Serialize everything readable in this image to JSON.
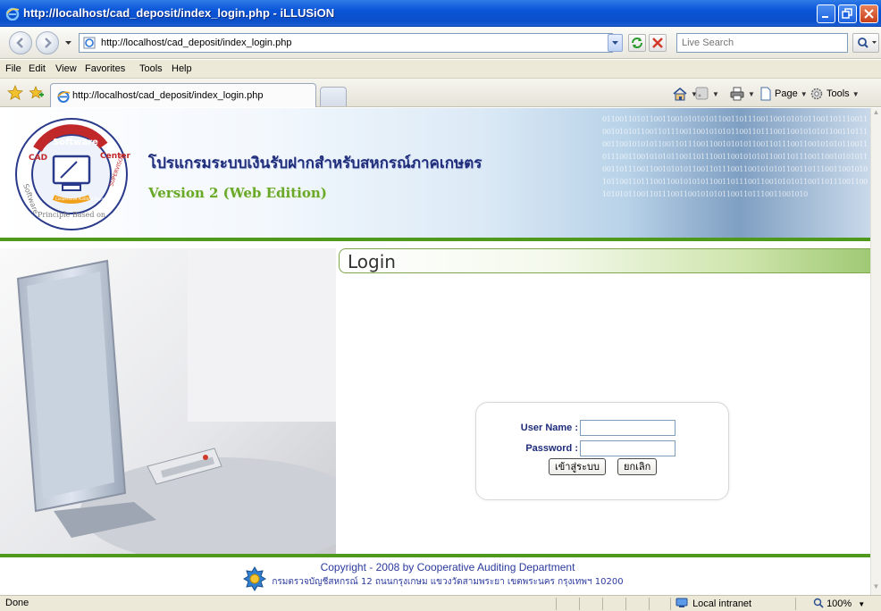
{
  "window": {
    "title": "http://localhost/cad_deposit/index_login.php - iLLUSiON"
  },
  "address_bar": {
    "url": "http://localhost/cad_deposit/index_login.php",
    "search_placeholder": "Live Search"
  },
  "menu": [
    "File",
    "Edit",
    "View",
    "Favorites",
    "Tools",
    "Help"
  ],
  "tabs": [
    {
      "title": "http://localhost/cad_deposit/index_login.php"
    }
  ],
  "command_bar": {
    "page_label": "Page",
    "tools_label": "Tools"
  },
  "banner": {
    "app_title": "โปรแกรมระบบเงินรับฝากสำหรับสหกรณ์ภาคเกษตร",
    "version": "Version 2 (Web Edition)",
    "logo_text": {
      "top": "Software",
      "left": "CAD Software",
      "center": "Center",
      "bottom": "Principle Based on",
      "badge": "Cooperative Auditing Department",
      "right": "SUPERVISOR concept"
    }
  },
  "login": {
    "header": "Login",
    "username_label": "User Name :",
    "password_label": "Password :",
    "username_value": "",
    "password_value": "",
    "login_button": "เข้าสู่ระบบ",
    "cancel_button": "ยกเลิก"
  },
  "footer": {
    "copyright": "Copyright - 2008 by Cooperative Auditing Department",
    "address": "กรมตรวจบัญชีสหกรณ์ 12 ถนนกรุงเกษม แขวงวัดสามพระยา เขตพระนคร กรุงเทพฯ 10200"
  },
  "status_bar": {
    "status": "Done",
    "zone": "Local intranet",
    "zoom": "100%"
  },
  "colors": {
    "titlebar": "#0b55d8",
    "app_title": "#1f2d7a",
    "version": "#6aa82a",
    "accent_green": "#4f9a1c",
    "label_blue": "#1e2c7a",
    "footer_text": "#2b3a9c"
  }
}
